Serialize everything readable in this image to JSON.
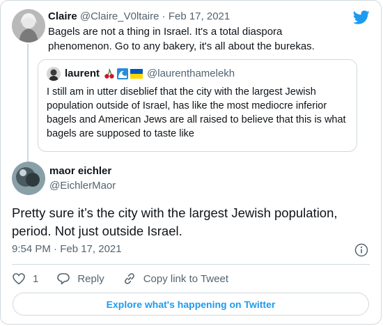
{
  "parent_tweet": {
    "name": "Claire",
    "handle": "@Claire_V0ltaire",
    "separator": "·",
    "date": "Feb 17, 2021",
    "text": "Bagels are not a thing in Israel. It's a total diaspora phenomenon. Go to any bakery, it's all about the burekas.",
    "quoted": {
      "name": "laurent",
      "emoji": "🍒 🌊 🇺🇦",
      "handle": "@laurenthamelekh",
      "text": "I still am in utter diseblief that the city with the largest Jewish population outside of Israel, has like the most mediocre inferior bagels and American Jews are all raised to believe that this is what bagels are supposed to taste like"
    }
  },
  "main_tweet": {
    "name": "maor eichler",
    "handle": "@EichlerMaor",
    "text": "Pretty sure it’s the city with the largest Jewish population, period. Not just outside Israel.",
    "timestamp": "9:54 PM · Feb 17, 2021"
  },
  "actions": {
    "like_count": "1",
    "reply_label": "Reply",
    "copy_label": "Copy link to Tweet"
  },
  "explore_label": "Explore what's happening on Twitter",
  "colors": {
    "accent": "#1d9bf0",
    "muted": "#536471",
    "border": "#cfd9de"
  },
  "icons": [
    "twitter-bird-icon",
    "info-icon",
    "heart-icon",
    "reply-icon",
    "link-icon"
  ]
}
